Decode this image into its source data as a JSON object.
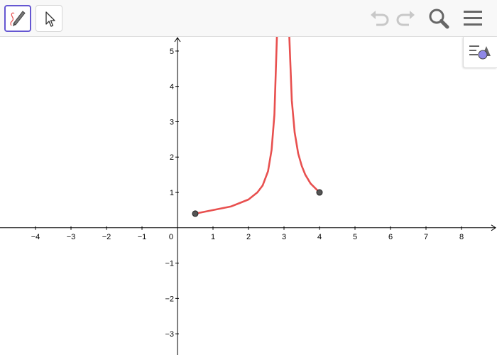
{
  "toolbar": {
    "tools": [
      {
        "name": "freehand-pen-tool",
        "active": true
      },
      {
        "name": "move-pointer-tool",
        "active": false
      }
    ],
    "icons": [
      "undo-icon",
      "redo-icon",
      "search-icon",
      "menu-icon",
      "style-bar-icon"
    ],
    "accent_color": "#6557d2"
  },
  "chart_data": {
    "type": "line",
    "xlim": [
      -5,
      9
    ],
    "ylim": [
      -3.6,
      5.4
    ],
    "grid": false,
    "x_ticks": [
      -4,
      -3,
      -2,
      -1,
      1,
      2,
      3,
      4,
      5,
      6,
      7,
      8
    ],
    "y_ticks": [
      -3,
      -2,
      -1,
      1,
      2,
      3,
      4,
      5
    ],
    "x_tick_labels": [
      "−4",
      "−3",
      "−2",
      "−1",
      "1",
      "2",
      "3",
      "4",
      "5",
      "6",
      "7",
      "8"
    ],
    "y_tick_labels": [
      "−3",
      "−2",
      "−1",
      "1",
      "2",
      "3",
      "4",
      "5"
    ],
    "origin_label": "0",
    "series": [
      {
        "color": "#e8504f",
        "segments": [
          {
            "x": [
              0.5,
              1,
              1.5,
              1.75,
              2,
              2.25,
              2.4,
              2.55,
              2.65,
              2.73,
              2.8
            ],
            "y": [
              0.4,
              0.5,
              0.6,
              0.7,
              0.8,
              1.0,
              1.2,
              1.6,
              2.2,
              3.2,
              5.4
            ]
          },
          {
            "x": [
              3.15,
              3.22,
              3.3,
              3.4,
              3.5,
              3.6,
              3.75,
              4.0
            ],
            "y": [
              5.4,
              3.6,
              2.7,
              2.1,
              1.75,
              1.5,
              1.25,
              1.0
            ]
          }
        ]
      }
    ],
    "points": [
      {
        "x": 0.5,
        "y": 0.4
      },
      {
        "x": 4.0,
        "y": 1.0
      }
    ],
    "point_color": "#555555"
  }
}
